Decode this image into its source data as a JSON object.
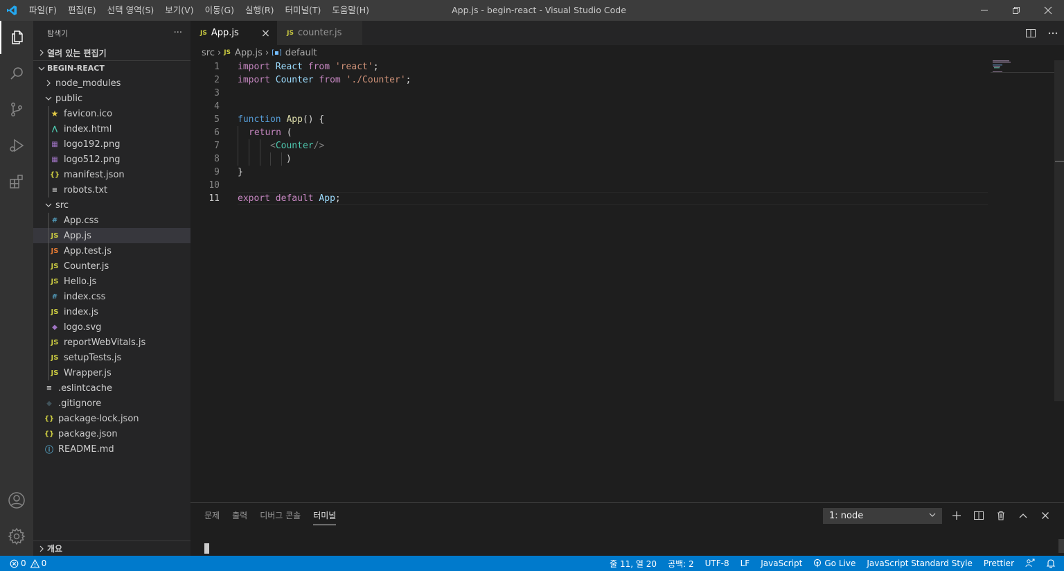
{
  "titlebar": {
    "menu": [
      "파일(F)",
      "편집(E)",
      "선택 영역(S)",
      "보기(V)",
      "이동(G)",
      "실행(R)",
      "터미널(T)",
      "도움말(H)"
    ],
    "window_title": "App.js - begin-react - Visual Studio Code"
  },
  "sidebar": {
    "title": "탐색기",
    "more": "···",
    "open_editors": "열려 있는 편집기",
    "project": "BEGIN-REACT",
    "tree": [
      {
        "label": "node_modules",
        "type": "folder-collapsed"
      },
      {
        "label": "public",
        "type": "folder-open"
      },
      {
        "label": "favicon.ico",
        "icon": "star"
      },
      {
        "label": "index.html",
        "icon": "html"
      },
      {
        "label": "logo192.png",
        "icon": "image"
      },
      {
        "label": "logo512.png",
        "icon": "image"
      },
      {
        "label": "manifest.json",
        "icon": "json"
      },
      {
        "label": "robots.txt",
        "icon": "text"
      },
      {
        "label": "src",
        "type": "folder-open"
      },
      {
        "label": "App.css",
        "icon": "css"
      },
      {
        "label": "App.js",
        "icon": "js",
        "selected": true
      },
      {
        "label": "App.test.js",
        "icon": "js-test"
      },
      {
        "label": "Counter.js",
        "icon": "js"
      },
      {
        "label": "Hello.js",
        "icon": "js"
      },
      {
        "label": "index.css",
        "icon": "css"
      },
      {
        "label": "index.js",
        "icon": "js"
      },
      {
        "label": "logo.svg",
        "icon": "svg"
      },
      {
        "label": "reportWebVitals.js",
        "icon": "js"
      },
      {
        "label": "setupTests.js",
        "icon": "js"
      },
      {
        "label": "Wrapper.js",
        "icon": "js"
      },
      {
        "label": ".eslintcache",
        "icon": "text"
      },
      {
        "label": ".gitignore",
        "icon": "git"
      },
      {
        "label": "package-lock.json",
        "icon": "json"
      },
      {
        "label": "package.json",
        "icon": "json"
      },
      {
        "label": "README.md",
        "icon": "info"
      }
    ],
    "outline": "개요"
  },
  "tabs": [
    {
      "icon": "JS",
      "label": "App.js",
      "active": true,
      "close": "×"
    },
    {
      "icon": "JS",
      "label": "counter.js",
      "active": false
    }
  ],
  "breadcrumb": {
    "folder": "src",
    "file": "App.js",
    "symbol": "default"
  },
  "editor": {
    "line_numbers": [
      "1",
      "2",
      "3",
      "4",
      "5",
      "6",
      "7",
      "8",
      "9",
      "10",
      "11"
    ],
    "current_line": "11",
    "code": {
      "l1": {
        "kw": "import",
        "id": "React",
        "from": "from",
        "str": "'react'",
        "end": ";"
      },
      "l2": {
        "kw": "import",
        "id": "Counter",
        "from": "from",
        "str": "'./Counter'",
        "end": ";"
      },
      "l5": {
        "kw": "function",
        "name": "App",
        "rest": "() {"
      },
      "l6": {
        "kw": "return",
        "rest": " ("
      },
      "l7": {
        "open": "<",
        "tag": "Counter",
        "close": "/>"
      },
      "l8": {
        "text": ")"
      },
      "l9": {
        "text": "}"
      },
      "l11": {
        "kw": "export",
        "kw2": "default",
        "id": "App",
        "end": ";"
      }
    }
  },
  "panel": {
    "tabs": [
      "문제",
      "출력",
      "디버그 콘솔",
      "터미널"
    ],
    "active_tab": "터미널",
    "terminal_select": "1: node"
  },
  "statusbar": {
    "errors": "0",
    "warnings": "0",
    "position": "줄 11, 열 20",
    "indent": "공백: 2",
    "encoding": "UTF-8",
    "eol": "LF",
    "language": "JavaScript",
    "golive": "Go Live",
    "linter": "JavaScript Standard Style",
    "formatter": "Prettier"
  },
  "colors": {
    "accent": "#007acc",
    "js_icon": "#cbcb41",
    "keyword": "#c586c0",
    "string": "#ce9178"
  }
}
